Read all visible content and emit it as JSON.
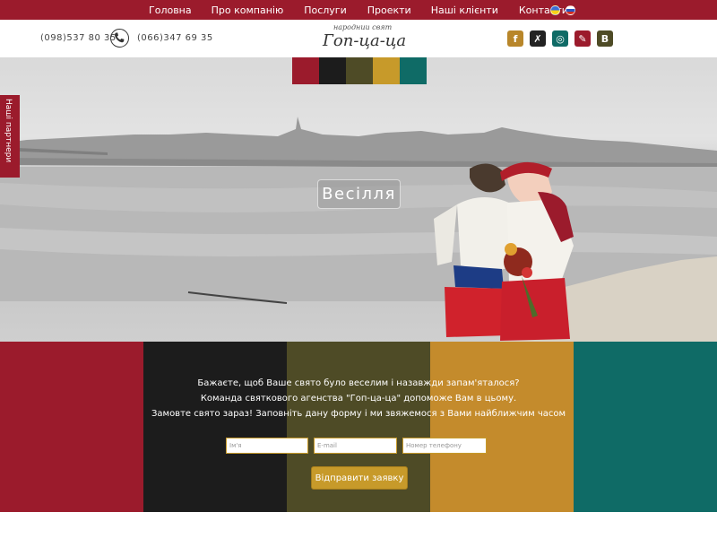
{
  "nav": {
    "items": [
      "Головна",
      "Про компанію",
      "Послуги",
      "Проекти",
      "Наші клієнти",
      "Контакти"
    ]
  },
  "header": {
    "phone1": "(098)537 80 35",
    "phone2": "(066)347 69 35",
    "logo_tagline": "народнии свят",
    "logo_name": "Гоп-ца-ца",
    "social_icons": [
      "facebook-icon",
      "vkontakte-icon",
      "instagram-icon",
      "odnoklassniki-icon",
      "b-icon"
    ],
    "social_glyphs": [
      "f",
      "✗",
      "◎",
      "✎",
      "B"
    ]
  },
  "hero": {
    "title": "Весілля",
    "partners_tab": "Наші партнери",
    "tile_colors": [
      "#9b1b2c",
      "#1c1c1c",
      "#4e4b26",
      "#c79a2a",
      "#0f6b66"
    ]
  },
  "form": {
    "line1": "Бажаєте, щоб Ваше свято було веселим і назавжди запам'яталося?",
    "line2": "Команда святкового агенства \"Гоп-ца-ца\" допоможе Вам в цьому.",
    "line3": "Замовте свято зараз! Заповніть дану форму і ми звяжемося з Вами найближчим часом",
    "name_placeholder": "Ім'я",
    "email_placeholder": "E-mail",
    "phone_placeholder": "Номер телефону",
    "submit_label": "Відправити заявку",
    "stripe_colors": [
      "#9b1b2c",
      "#1c1c1c",
      "#4e4b26",
      "#c48b2c",
      "#0f6b66"
    ]
  }
}
